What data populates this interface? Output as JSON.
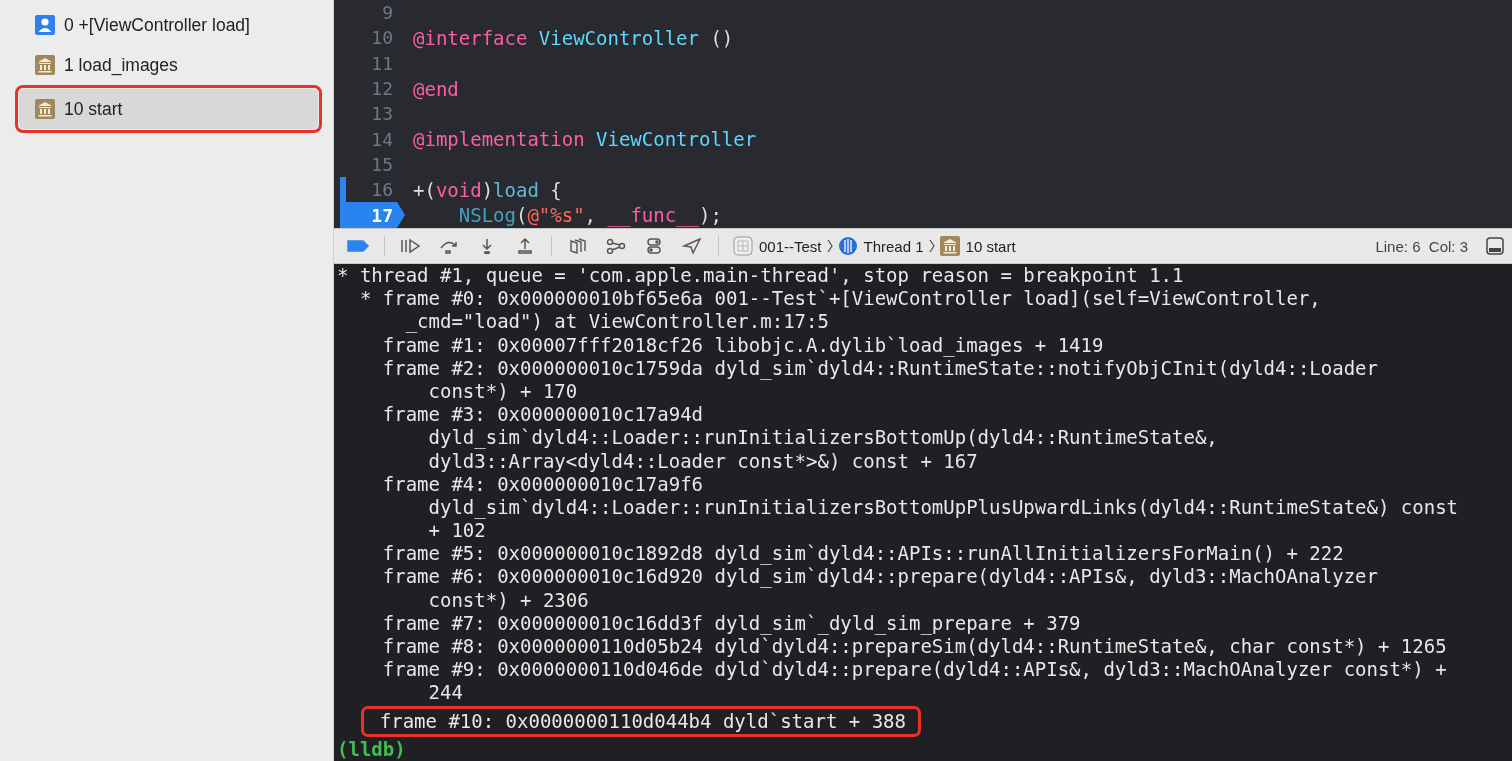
{
  "sidebar": {
    "items": [
      {
        "label": "0 +[ViewController load]",
        "kind": "person",
        "selected": false,
        "highlighted": false
      },
      {
        "label": "1 load_images",
        "kind": "library",
        "selected": false,
        "highlighted": false
      },
      {
        "label": "10 start",
        "kind": "library",
        "selected": true,
        "highlighted": true
      }
    ]
  },
  "editor": {
    "lines": [
      {
        "number": "9",
        "changed": false,
        "breakpoint": false
      },
      {
        "number": "10",
        "changed": false,
        "breakpoint": false,
        "tokens": [
          {
            "kind": "keyword",
            "text": "@interface"
          },
          {
            "kind": "type",
            "text": " ViewController"
          },
          {
            "kind": "plain",
            "text": " ()"
          }
        ]
      },
      {
        "number": "11",
        "changed": false,
        "breakpoint": false
      },
      {
        "number": "12",
        "changed": false,
        "breakpoint": false,
        "tokens": [
          {
            "kind": "keyword",
            "text": "@end"
          }
        ]
      },
      {
        "number": "13",
        "changed": false,
        "breakpoint": false
      },
      {
        "number": "14",
        "changed": false,
        "breakpoint": false,
        "tokens": [
          {
            "kind": "keyword",
            "text": "@implementation"
          },
          {
            "kind": "type",
            "text": " ViewController"
          }
        ]
      },
      {
        "number": "15",
        "changed": false,
        "breakpoint": false
      },
      {
        "number": "16",
        "changed": true,
        "breakpoint": false,
        "tokens": [
          {
            "kind": "plain",
            "text": "+("
          },
          {
            "kind": "keyword",
            "text": "void"
          },
          {
            "kind": "plain",
            "text": ")"
          },
          {
            "kind": "method",
            "text": "load"
          },
          {
            "kind": "plain",
            "text": " {"
          }
        ]
      },
      {
        "number": "17",
        "changed": true,
        "breakpoint": true,
        "tokens": [
          {
            "kind": "function",
            "text": "    NSLog"
          },
          {
            "kind": "plain",
            "text": "("
          },
          {
            "kind": "string",
            "text": "@\"%s\""
          },
          {
            "kind": "plain",
            "text": ", "
          },
          {
            "kind": "keyword",
            "text": "__func__"
          },
          {
            "kind": "plain",
            "text": ");"
          }
        ]
      }
    ]
  },
  "debug_bar": {
    "breakpoints_active": true,
    "breadcrumbs": [
      {
        "label": "001--Test",
        "kind": "app"
      },
      {
        "label": "Thread 1",
        "kind": "thread"
      },
      {
        "label": "10 start",
        "kind": "library"
      }
    ],
    "position": "Line: 6  Col: 3"
  },
  "console": {
    "lines": [
      {
        "kind": "output",
        "text": "* thread #1, queue = 'com.apple.main-thread', stop reason = breakpoint 1.1",
        "highlighted": false
      },
      {
        "kind": "output",
        "text": "  * frame #0: 0x000000010bf65e6a 001--Test`+[ViewController load](self=ViewController,",
        "highlighted": false
      },
      {
        "kind": "output",
        "text": "      _cmd=\"load\") at ViewController.m:17:5",
        "highlighted": false
      },
      {
        "kind": "output",
        "text": "    frame #1: 0x00007fff2018cf26 libobjc.A.dylib`load_images + 1419",
        "highlighted": false
      },
      {
        "kind": "output",
        "text": "    frame #2: 0x000000010c1759da dyld_sim`dyld4::RuntimeState::notifyObjCInit(dyld4::Loader",
        "highlighted": false
      },
      {
        "kind": "output",
        "text": "        const*) + 170",
        "highlighted": false
      },
      {
        "kind": "output",
        "text": "    frame #3: 0x000000010c17a94d",
        "highlighted": false
      },
      {
        "kind": "output",
        "text": "        dyld_sim`dyld4::Loader::runInitializersBottomUp(dyld4::RuntimeState&,",
        "highlighted": false
      },
      {
        "kind": "output",
        "text": "        dyld3::Array<dyld4::Loader const*>&) const + 167",
        "highlighted": false
      },
      {
        "kind": "output",
        "text": "    frame #4: 0x000000010c17a9f6",
        "highlighted": false
      },
      {
        "kind": "output",
        "text": "        dyld_sim`dyld4::Loader::runInitializersBottomUpPlusUpwardLinks(dyld4::RuntimeState&) const",
        "highlighted": false
      },
      {
        "kind": "output",
        "text": "        + 102",
        "highlighted": false
      },
      {
        "kind": "output",
        "text": "    frame #5: 0x000000010c1892d8 dyld_sim`dyld4::APIs::runAllInitializersForMain() + 222",
        "highlighted": false
      },
      {
        "kind": "output",
        "text": "    frame #6: 0x000000010c16d920 dyld_sim`dyld4::prepare(dyld4::APIs&, dyld3::MachOAnalyzer",
        "highlighted": false
      },
      {
        "kind": "output",
        "text": "        const*) + 2306",
        "highlighted": false
      },
      {
        "kind": "output",
        "text": "    frame #7: 0x000000010c16dd3f dyld_sim`_dyld_sim_prepare + 379",
        "highlighted": false
      },
      {
        "kind": "output",
        "text": "    frame #8: 0x0000000110d05b24 dyld`dyld4::prepareSim(dyld4::RuntimeState&, char const*) + 1265",
        "highlighted": false
      },
      {
        "kind": "output",
        "text": "    frame #9: 0x0000000110d046de dyld`dyld4::prepare(dyld4::APIs&, dyld3::MachOAnalyzer const*) +",
        "highlighted": false
      },
      {
        "kind": "output",
        "text": "        244",
        "highlighted": false
      },
      {
        "kind": "output",
        "text": "    frame #10: 0x0000000110d044b4 dyld`start + 388",
        "highlighted": true
      },
      {
        "kind": "prompt",
        "text": "(lldb)"
      }
    ]
  }
}
